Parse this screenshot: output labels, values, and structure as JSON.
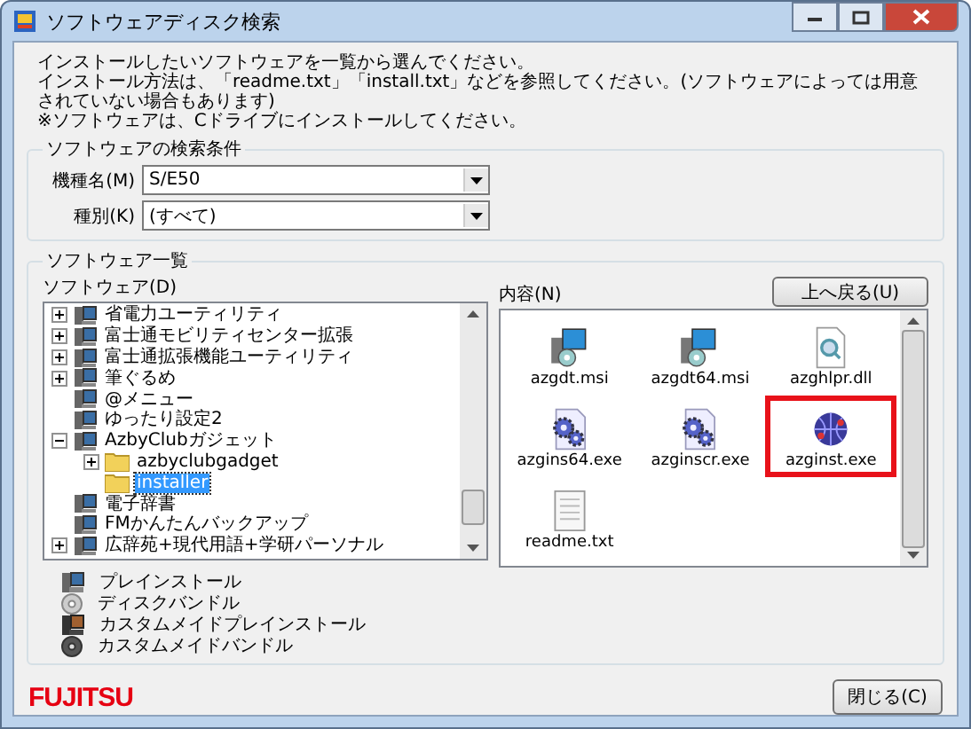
{
  "window": {
    "title": "ソフトウェアディスク検索"
  },
  "intro": [
    "インストールしたいソフトウェアを一覧から選んでください。",
    "インストール方法は、「readme.txt」「install.txt」などを参照してください。(ソフトウェアによっては用意されていない場合もあります)",
    "※ソフトウェアは、Cドライブにインストールしてください。"
  ],
  "search_group": {
    "title": "ソフトウェアの検索条件",
    "fields": [
      {
        "label": "機種名(M)",
        "value": "S/E50"
      },
      {
        "label": "種別(K)",
        "value": "(すべて)"
      }
    ]
  },
  "list_group": {
    "title": "ソフトウェア一覧",
    "tree": {
      "label": "ソフトウェア(D)",
      "items": [
        {
          "label": "省電力ユーティリティ",
          "kind": "software",
          "expanded": false,
          "selected": false
        },
        {
          "label": "富士通モビリティセンター拡張",
          "kind": "software",
          "expanded": false,
          "selected": false
        },
        {
          "label": "富士通拡張機能ユーティリティ",
          "kind": "software",
          "expanded": false,
          "selected": false
        },
        {
          "label": "筆ぐるめ",
          "kind": "software",
          "expanded": false,
          "selected": false
        },
        {
          "label": "@メニュー",
          "kind": "software",
          "selected": false
        },
        {
          "label": "ゆったり設定2",
          "kind": "software",
          "selected": false
        },
        {
          "label": "AzbyClubガジェット",
          "kind": "software",
          "expanded": true,
          "selected": false,
          "children": [
            {
              "label": "azbyclubgadget",
              "kind": "folder",
              "expanded": false,
              "selected": false
            },
            {
              "label": "installer",
              "kind": "folder",
              "selected": true
            }
          ]
        },
        {
          "label": "電子辞書",
          "kind": "software",
          "selected": false
        },
        {
          "label": "FMかんたんバックアップ",
          "kind": "software",
          "selected": false
        },
        {
          "label": "広辞苑+現代用語+学研パーソナル",
          "kind": "software",
          "expanded": false,
          "selected": false
        }
      ]
    },
    "contents": {
      "label": "内容(N)",
      "up_button": "上へ戻る(U)",
      "files": [
        {
          "name": "azgdt.msi",
          "kind": "installer",
          "highlighted": false
        },
        {
          "name": "azgdt64.msi",
          "kind": "installer",
          "highlighted": false
        },
        {
          "name": "azghlpr.dll",
          "kind": "dll",
          "highlighted": false
        },
        {
          "name": "azgins64.exe",
          "kind": "gear",
          "highlighted": false
        },
        {
          "name": "azginscr.exe",
          "kind": "gear",
          "highlighted": false
        },
        {
          "name": "azginst.exe",
          "kind": "globe",
          "highlighted": true
        },
        {
          "name": "readme.txt",
          "kind": "text",
          "highlighted": false
        }
      ]
    },
    "legend": [
      {
        "label": "プレインストール",
        "kind": "preinstall"
      },
      {
        "label": "ディスクバンドル",
        "kind": "bundle"
      },
      {
        "label": "カスタムメイドプレインストール",
        "kind": "custom-preinstall"
      },
      {
        "label": "カスタムメイドバンドル",
        "kind": "custom-bundle"
      }
    ]
  },
  "logo": "FUJITSU",
  "close_button": "閉じる(C)"
}
